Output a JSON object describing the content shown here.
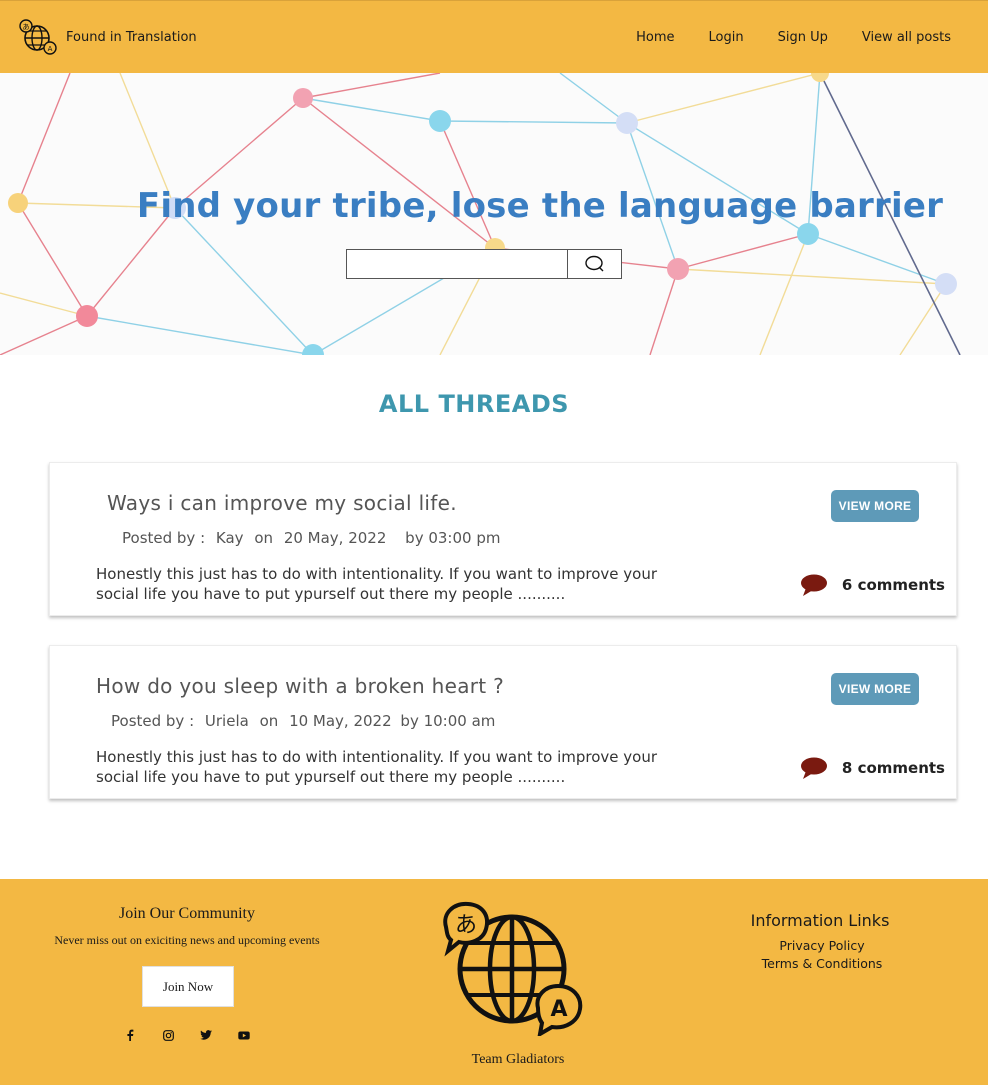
{
  "header": {
    "brand_name": "Found in Translation",
    "nav": [
      "Home",
      "Login",
      "Sign Up",
      "View all posts"
    ]
  },
  "hero": {
    "title": "Find your tribe, lose the language barrier",
    "search_value": "",
    "search_icon": "search-icon"
  },
  "threads": {
    "section_title": "ALL THREADS",
    "items": [
      {
        "title": "Ways i can improve my social life.",
        "posted_by_label": "Posted by :",
        "author": "Kay",
        "on_label": "on",
        "date": "20 May, 2022",
        "time": "by 03:00 pm",
        "excerpt": "Honestly this just has to do with intentionality. If you want to improve your social life you have to put ypurself out there my people ..........",
        "button_label": "VIEW MORE",
        "comments": "6 comments"
      },
      {
        "title": "How do you sleep with a broken heart ?",
        "posted_by_label": "Posted by :",
        "author": "Uriela",
        "on_label": "on",
        "date": "10 May, 2022",
        "time": "by 10:00 am",
        "excerpt": "Honestly this just has to do with intentionality. If you want to improve your social life you have to put ypurself out there my people ..........",
        "button_label": "VIEW MORE",
        "comments": "8 comments"
      }
    ]
  },
  "footer": {
    "join_title": "Join Our Community",
    "join_subtitle": "Never miss out on exiciting news and upcoming events",
    "join_button": "Join Now",
    "socials": [
      "facebook-icon",
      "instagram-icon",
      "twitter-icon",
      "youtube-icon"
    ],
    "team_name": "Team Gladiators",
    "info_title": "Information Links",
    "links": [
      "Privacy Policy",
      "Terms & Conditions"
    ]
  },
  "colors": {
    "header_bg": "#f3b843",
    "hero_title": "#3a7ec2",
    "section_title": "#3e97ae",
    "button_bg": "#5e9ab8",
    "comment_icon": "#7a1a10"
  }
}
